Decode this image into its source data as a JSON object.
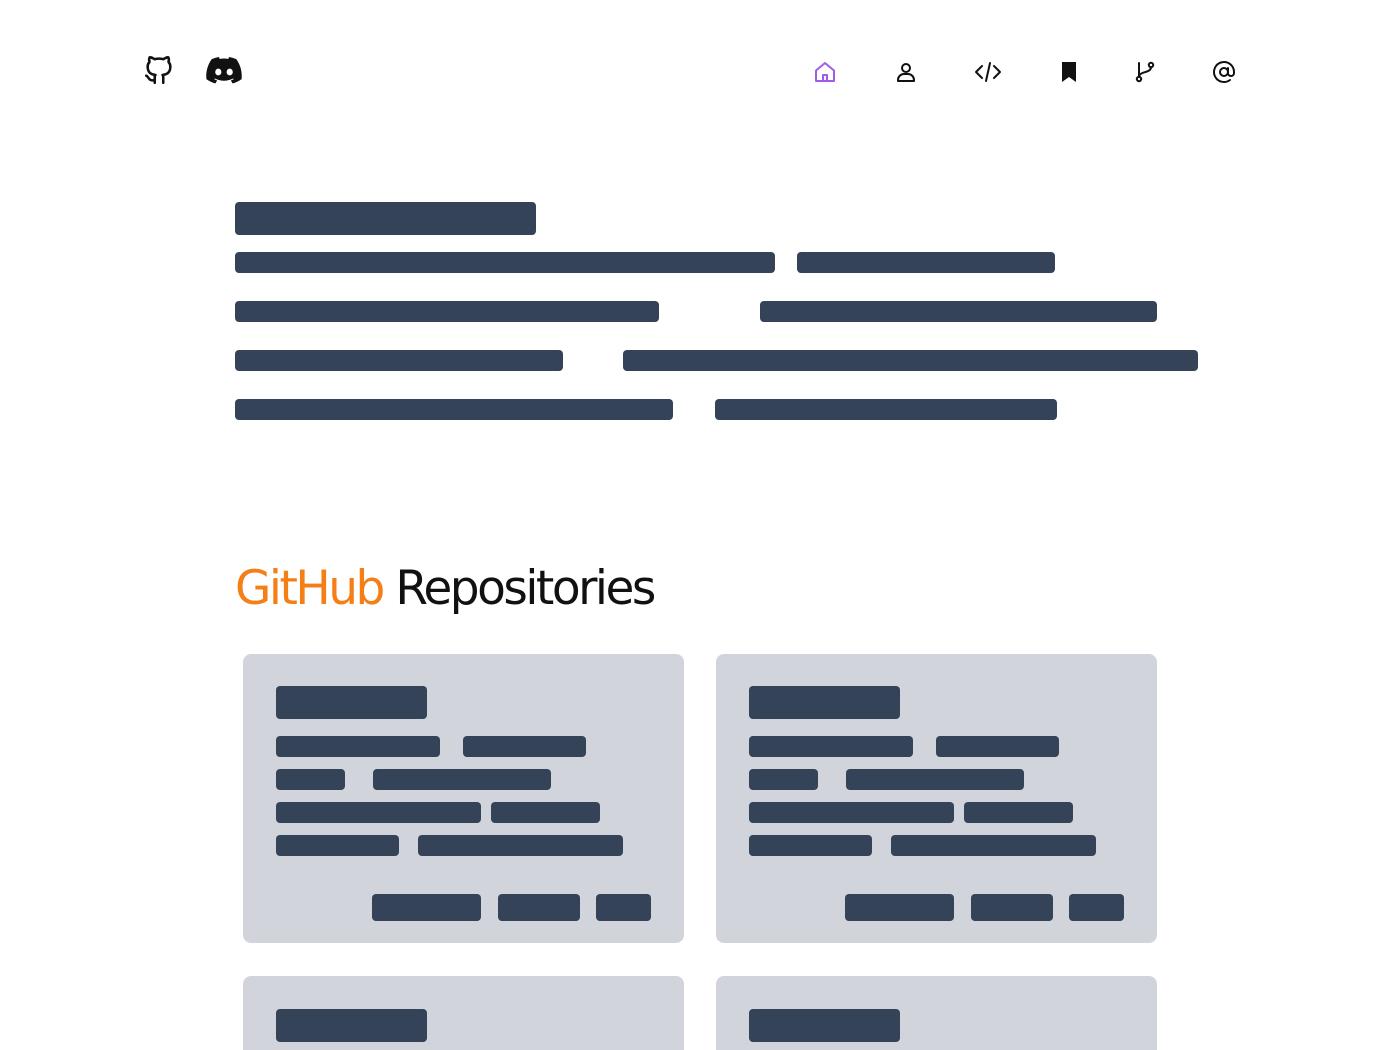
{
  "header": {
    "social": [
      {
        "name": "GitHub",
        "icon": "github-icon"
      },
      {
        "name": "Discord",
        "icon": "discord-icon"
      }
    ],
    "nav": [
      {
        "icon": "home-icon",
        "active": true
      },
      {
        "icon": "user-icon",
        "active": false
      },
      {
        "icon": "code-icon",
        "active": false
      },
      {
        "icon": "bookmark-icon",
        "active": false
      },
      {
        "icon": "git-branch-icon",
        "active": false
      },
      {
        "icon": "at-sign-icon",
        "active": false
      }
    ]
  },
  "section": {
    "heading_accent": "GitHub",
    "heading_rest": "Repositories"
  },
  "colors": {
    "accent": "#f57f17",
    "nav_active": "#a05ce8",
    "skeleton": "#344358",
    "card_bg": "#d1d5db"
  },
  "state": "loading-skeleton"
}
